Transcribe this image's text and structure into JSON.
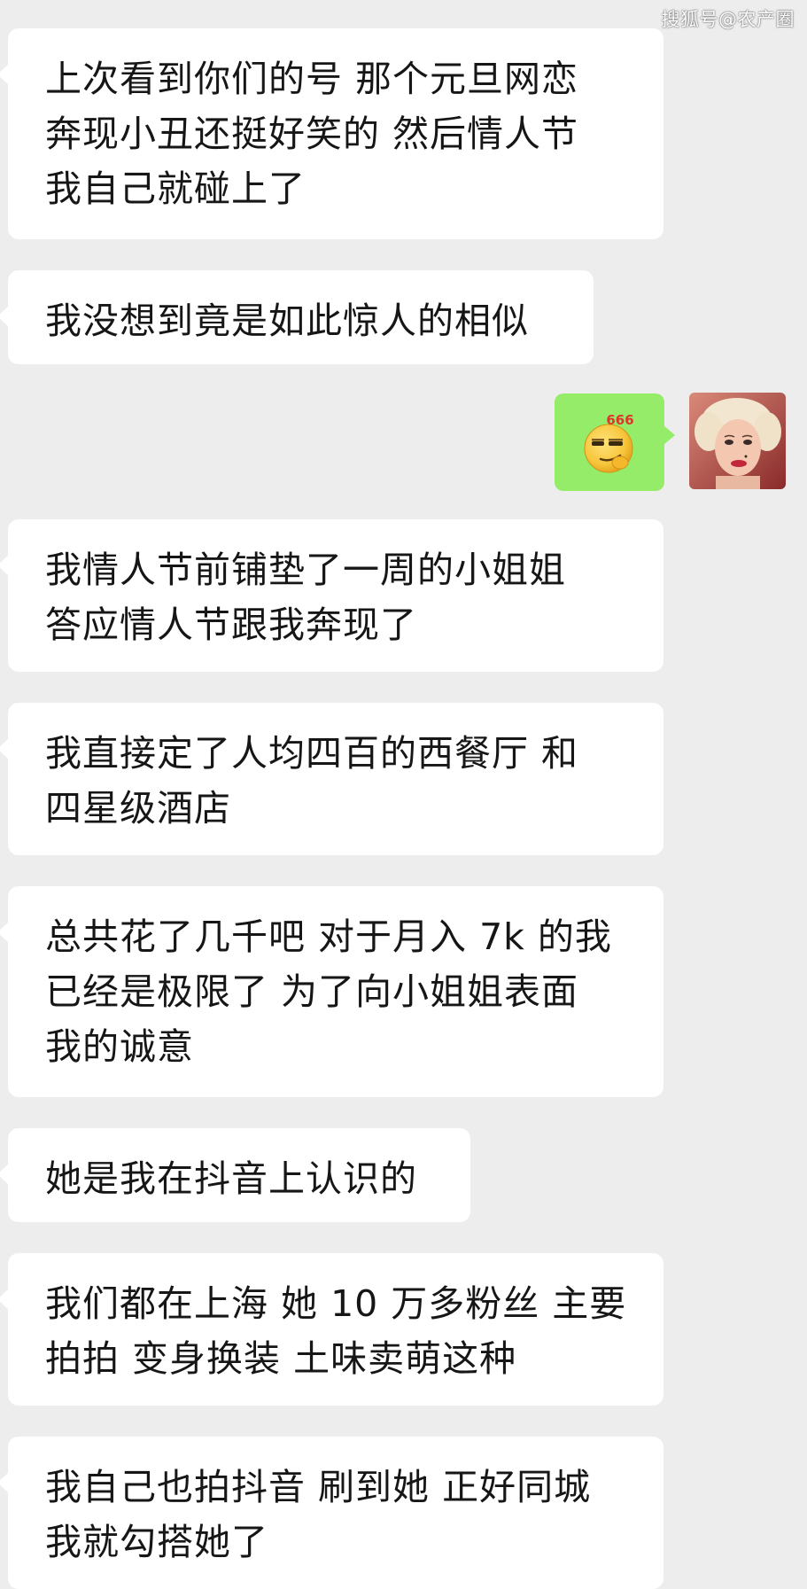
{
  "watermark": "搜狐号@农产圈",
  "messages": [
    {
      "direction": "in",
      "text": "上次看到你们的号 那个元旦网恋\n奔现小丑还挺好笑的 然后情人节\n我自己就碰上了"
    },
    {
      "direction": "in",
      "text": "我没想到竟是如此惊人的相似"
    },
    {
      "direction": "out",
      "sticker": "666-emoji"
    },
    {
      "direction": "in",
      "text": "我情人节前铺垫了一周的小姐姐\n答应情人节跟我奔现了"
    },
    {
      "direction": "in",
      "text": "我直接定了人均四百的西餐厅 和\n四星级酒店"
    },
    {
      "direction": "in",
      "text": "总共花了几千吧 对于月入 7k 的我\n已经是极限了 为了向小姐姐表面\n我的诚意"
    },
    {
      "direction": "in",
      "text": "她是我在抖音上认识的"
    },
    {
      "direction": "in",
      "text": "我们都在上海 她 10 万多粉丝 主要\n拍拍 变身换装 土味卖萌这种"
    },
    {
      "direction": "in",
      "text": "我自己也拍抖音 刷到她 正好同城\n我就勾搭她了"
    }
  ],
  "sticker_text": "666",
  "colors": {
    "background": "#ededed",
    "incoming_bubble": "#ffffff",
    "outgoing_bubble": "#95ec69",
    "text": "#161616"
  },
  "icons": [
    "smirk-666-emoji-icon",
    "avatar-portrait"
  ]
}
